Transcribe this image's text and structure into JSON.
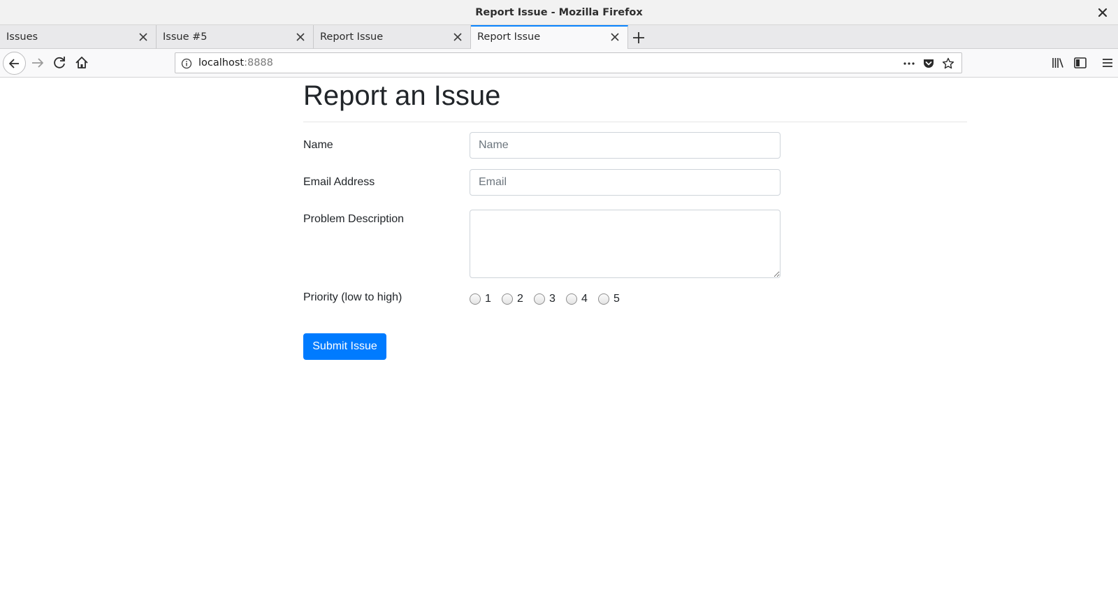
{
  "window": {
    "title": "Report Issue - Mozilla Firefox"
  },
  "tabs": [
    {
      "label": "Issues",
      "active": false
    },
    {
      "label": "Issue #5",
      "active": false
    },
    {
      "label": "Report Issue",
      "active": false
    },
    {
      "label": "Report Issue",
      "active": true
    }
  ],
  "urlbar": {
    "host": "localhost",
    "port": ":8888"
  },
  "icons": {
    "back": "back-arrow-icon",
    "forward": "forward-arrow-icon",
    "reload": "reload-icon",
    "home": "home-icon",
    "info": "info-icon",
    "page_actions": "more-icon",
    "pocket": "pocket-icon",
    "bookmark": "star-icon",
    "library": "library-icon",
    "sidebar": "sidebar-icon",
    "menu": "hamburger-menu-icon"
  },
  "page": {
    "heading": "Report an Issue",
    "form": {
      "name_label": "Name",
      "name_placeholder": "Name",
      "email_label": "Email Address",
      "email_placeholder": "Email",
      "description_label": "Problem Description",
      "priority_label": "Priority (low to high)",
      "priority_options": [
        "1",
        "2",
        "3",
        "4",
        "5"
      ],
      "submit_label": "Submit Issue"
    }
  },
  "colors": {
    "accent": "#007bff",
    "tab_highlight": "#0a84ff"
  }
}
